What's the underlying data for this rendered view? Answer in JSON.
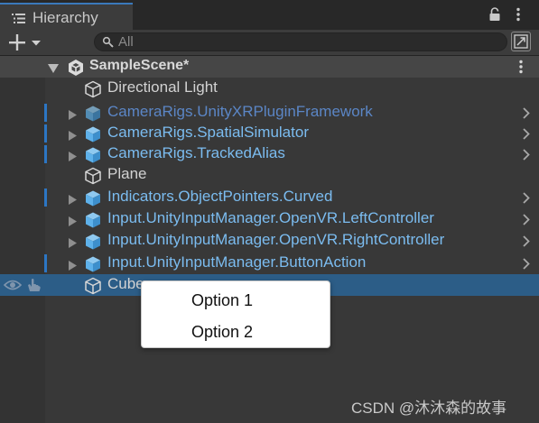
{
  "window": {
    "tab_title": "Hierarchy"
  },
  "search": {
    "placeholder": "All",
    "value": ""
  },
  "scene": {
    "name": "SampleScene*"
  },
  "rows": [
    {
      "label": "Directional Light",
      "kind": "gameobject",
      "expandable": false,
      "override_marker": false,
      "child_arrow": false
    },
    {
      "label": "CameraRigs.UnityXRPluginFramework",
      "kind": "prefab-inactive",
      "expandable": true,
      "override_marker": true,
      "child_arrow": true
    },
    {
      "label": "CameraRigs.SpatialSimulator",
      "kind": "prefab",
      "expandable": true,
      "override_marker": true,
      "child_arrow": true
    },
    {
      "label": "CameraRigs.TrackedAlias",
      "kind": "prefab",
      "expandable": true,
      "override_marker": true,
      "child_arrow": true
    },
    {
      "label": "Plane",
      "kind": "gameobject",
      "expandable": false,
      "override_marker": false,
      "child_arrow": false
    },
    {
      "label": "Indicators.ObjectPointers.Curved",
      "kind": "prefab",
      "expandable": true,
      "override_marker": true,
      "child_arrow": true
    },
    {
      "label": "Input.UnityInputManager.OpenVR.LeftController",
      "kind": "prefab",
      "expandable": true,
      "override_marker": false,
      "child_arrow": true
    },
    {
      "label": "Input.UnityInputManager.OpenVR.RightController",
      "kind": "prefab",
      "expandable": true,
      "override_marker": false,
      "child_arrow": true
    },
    {
      "label": "Input.UnityInputManager.ButtonAction",
      "kind": "prefab",
      "expandable": true,
      "override_marker": true,
      "child_arrow": true
    },
    {
      "label": "Cube",
      "kind": "gameobject",
      "expandable": false,
      "override_marker": false,
      "child_arrow": false,
      "selected": true
    }
  ],
  "context_menu": {
    "items": [
      "Option 1",
      "Option 2"
    ]
  },
  "watermark": "CSDN @沐沐森的故事",
  "icons": {
    "tab": "hierarchy-list-icon",
    "lock": "lock-icon",
    "kebab": "kebab-menu-icon",
    "add": "plus-dropdown-icon",
    "search": "search-icon",
    "expand": "search-expand-icon",
    "scene": "unity-scene-icon",
    "gameobject": "cube-outline-icon",
    "prefab": "prefab-cube-icon",
    "fold": "triangle-right-icon",
    "chevron": "chevron-right-icon",
    "visibility": "eye-icon",
    "pickable": "hand-icon"
  },
  "colors": {
    "selection": "#2c5d87",
    "prefab_text": "#7bbcf0",
    "prefab_inactive_text": "#5b86c6",
    "prefab_icon": "#5eb1ea",
    "override_marker": "#2c76c4",
    "tab_accent": "#3a79bb"
  }
}
